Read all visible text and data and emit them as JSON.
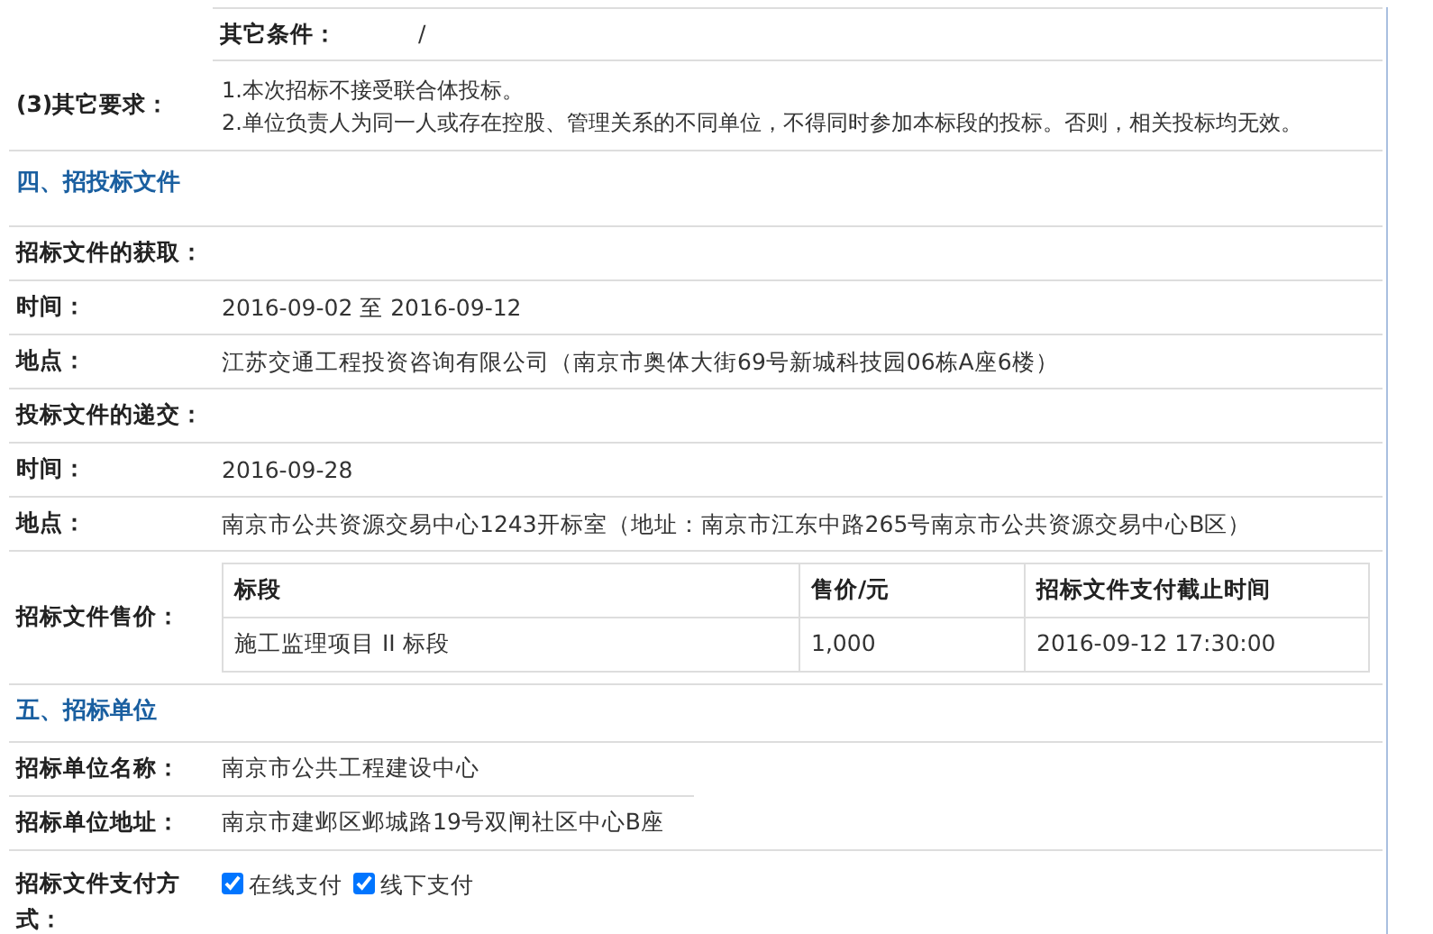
{
  "rows": [
    {
      "kind": "condition",
      "label": "其它条件：",
      "value": "/"
    },
    {
      "kind": "lines",
      "label": "(3)其它要求：",
      "lines": [
        "1.本次招标不接受联合体投标。",
        "2.单位负责人为同一人或存在控股、管理关系的不同单位，不得同时参加本标段的投标。否则，相关投标均无效。"
      ]
    },
    {
      "kind": "heading",
      "label": "四、招投标文件"
    },
    {
      "kind": "subheading",
      "label": "招标文件的获取："
    },
    {
      "kind": "field",
      "label": "时间：",
      "value": "2016-09-02 至 2016-09-12"
    },
    {
      "kind": "field",
      "label": "地点：",
      "value": "江苏交通工程投资咨询有限公司（南京市奥体大街69号新城科技园06栋A座6楼）"
    },
    {
      "kind": "subheading",
      "label": "投标文件的递交："
    },
    {
      "kind": "field",
      "label": "时间：",
      "value": "2016-09-28"
    },
    {
      "kind": "field",
      "label": "地点：",
      "value": "南京市公共资源交易中心1243开标室（地址：南京市江东中路265号南京市公共资源交易中心B区）"
    },
    {
      "kind": "table",
      "label": "招标文件售价：",
      "columns": [
        "标段",
        "售价/元",
        "招标文件支付截止时间"
      ],
      "cells": [
        [
          "施工监理项目 II 标段",
          "1,000",
          "2016-09-12 17:30:00"
        ]
      ]
    },
    {
      "kind": "heading",
      "label": "五、招标单位"
    },
    {
      "kind": "field",
      "label": "招标单位名称：",
      "value": "南京市公共工程建设中心",
      "short": true
    },
    {
      "kind": "field",
      "label": "招标单位地址：",
      "value": "南京市建邺区邺城路19号双闸社区中心B座"
    },
    {
      "kind": "checks",
      "label": "招标文件支付方式：",
      "options": [
        {
          "label": "在线支付",
          "checked": true
        },
        {
          "label": "线下支付",
          "checked": true
        }
      ]
    }
  ]
}
